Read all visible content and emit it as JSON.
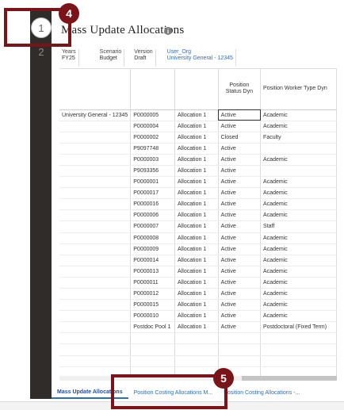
{
  "steps": {
    "step1": "1",
    "step2": "2"
  },
  "page_title": "Mass Update Allocations",
  "pov": [
    {
      "label": "Years",
      "value": "FY25"
    },
    {
      "label": "Scenario",
      "value": "Budget"
    },
    {
      "label": "Version",
      "value": "Draft"
    },
    {
      "label": "User_Org",
      "value": "University General - 12345"
    }
  ],
  "grid": {
    "headers": {
      "col4": "Position Status Dyn",
      "col5": "Position Worker Type Dyn"
    },
    "org_label": "University General - 12345",
    "rows": [
      {
        "position": "P0000005",
        "allocation": "Allocation 1",
        "status": "Active",
        "worker_type": "Academic"
      },
      {
        "position": "P0000004",
        "allocation": "Allocation 1",
        "status": "Active",
        "worker_type": "Academic"
      },
      {
        "position": "P0000002",
        "allocation": "Allocation 1",
        "status": "Closed",
        "worker_type": "Faculty"
      },
      {
        "position": "P9097748",
        "allocation": "Allocation 1",
        "status": "Active",
        "worker_type": ""
      },
      {
        "position": "P0000003",
        "allocation": "Allocation 1",
        "status": "Active",
        "worker_type": "Academic"
      },
      {
        "position": "P9093356",
        "allocation": "Allocation 1",
        "status": "Active",
        "worker_type": ""
      },
      {
        "position": "P0000001",
        "allocation": "Allocation 1",
        "status": "Active",
        "worker_type": "Academic"
      },
      {
        "position": "P0000017",
        "allocation": "Allocation 1",
        "status": "Active",
        "worker_type": "Academic"
      },
      {
        "position": "P0000016",
        "allocation": "Allocation 1",
        "status": "Active",
        "worker_type": "Academic"
      },
      {
        "position": "P0000006",
        "allocation": "Allocation 1",
        "status": "Active",
        "worker_type": "Academic"
      },
      {
        "position": "P0000007",
        "allocation": "Allocation 1",
        "status": "Active",
        "worker_type": "Staff"
      },
      {
        "position": "P0000008",
        "allocation": "Allocation 1",
        "status": "Active",
        "worker_type": "Academic"
      },
      {
        "position": "P0000009",
        "allocation": "Allocation 1",
        "status": "Active",
        "worker_type": "Academic"
      },
      {
        "position": "P0000014",
        "allocation": "Allocation 1",
        "status": "Active",
        "worker_type": "Academic"
      },
      {
        "position": "P0000013",
        "allocation": "Allocation 1",
        "status": "Active",
        "worker_type": "Academic"
      },
      {
        "position": "P0000011",
        "allocation": "Allocation 1",
        "status": "Active",
        "worker_type": "Academic"
      },
      {
        "position": "P0000012",
        "allocation": "Allocation 1",
        "status": "Active",
        "worker_type": "Academic"
      },
      {
        "position": "P0000015",
        "allocation": "Allocation 1",
        "status": "Active",
        "worker_type": "Academic"
      },
      {
        "position": "P0000010",
        "allocation": "Allocation 1",
        "status": "Active",
        "worker_type": "Academic"
      },
      {
        "position": "Postdoc Pool 1",
        "allocation": "Allocation 1",
        "status": "Active",
        "worker_type": "Postdoctoral (Fixed Term)"
      }
    ]
  },
  "tabs": [
    {
      "label": "Mass Update Allocations",
      "active": true
    },
    {
      "label": "Position Costing Allocations M...",
      "active": false
    },
    {
      "label": "Position Costing Allocations -...",
      "active": false
    }
  ],
  "callouts": {
    "c4": "4",
    "c5": "5"
  },
  "colors": {
    "callout": "#7a1418",
    "rail": "#2f2c29",
    "link": "#2a6ebb"
  }
}
